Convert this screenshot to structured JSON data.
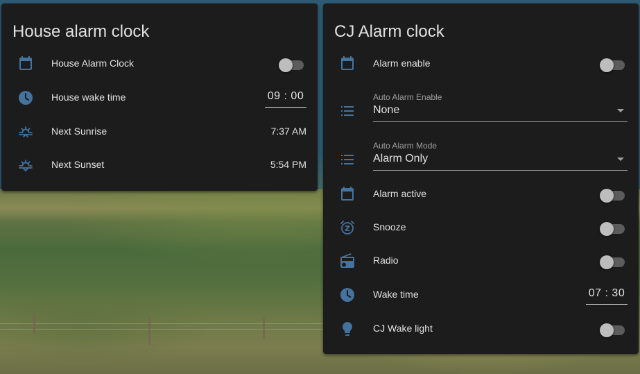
{
  "house_card": {
    "title": "House alarm clock",
    "rows": [
      {
        "label": "House Alarm Clock",
        "icon": "calendar-icon",
        "type": "toggle",
        "on": false
      },
      {
        "label": "House wake time",
        "icon": "clock-icon",
        "type": "time",
        "value": "09 : 00"
      },
      {
        "label": "Next Sunrise",
        "icon": "sunrise-icon",
        "type": "text",
        "value": "7:37 AM"
      },
      {
        "label": "Next Sunset",
        "icon": "sunset-icon",
        "type": "text",
        "value": "5:54 PM"
      }
    ]
  },
  "cj_card": {
    "title": "CJ Alarm clock",
    "alarm_enable": {
      "label": "Alarm enable",
      "icon": "calendar-icon",
      "on": false
    },
    "auto_alarm_enable": {
      "label": "Auto Alarm Enable",
      "value": "None",
      "icon": "list-icon"
    },
    "auto_alarm_mode": {
      "label": "Auto Alarm Mode",
      "value": "Alarm Only",
      "icon": "list-icon"
    },
    "alarm_active": {
      "label": "Alarm active",
      "icon": "calendar-icon",
      "on": false
    },
    "snooze": {
      "label": "Snooze",
      "icon": "snooze-alarm-icon",
      "on": false
    },
    "radio": {
      "label": "Radio",
      "icon": "radio-icon",
      "on": false
    },
    "wake_time": {
      "label": "Wake time",
      "icon": "clock-icon",
      "value": "07 : 30"
    },
    "wake_light": {
      "label": "CJ Wake light",
      "icon": "lightbulb-icon",
      "on": false
    }
  },
  "colors": {
    "card_bg": "#1c1c1c",
    "text": "#e1e1e1",
    "icon": "#44739e",
    "secondary_text": "#9e9e9e",
    "toggle_track": "#5c5c5c",
    "toggle_thumb": "#bdbdbd"
  }
}
